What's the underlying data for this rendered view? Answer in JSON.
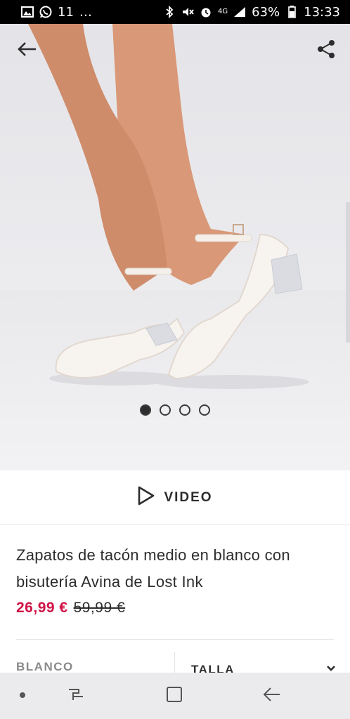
{
  "status_bar": {
    "notification_count": "11",
    "ellipsis": "…",
    "network": "4G",
    "battery": "63%",
    "time": "13:33"
  },
  "product": {
    "title": "Zapatos de tacón medio en blanco con bisutería Avina de Lost Ink",
    "price_now": "26,99 €",
    "price_old": "59,99 €",
    "gallery_count": 4,
    "gallery_active_index": 0
  },
  "video": {
    "label": "VIDEO"
  },
  "selectors": {
    "colour": "BLANCO",
    "size_label": "TALLA"
  },
  "icons": {
    "back": "arrow-left-icon",
    "share": "share-icon",
    "video": "play-icon",
    "size_dropdown": "chevron-down-icon"
  },
  "colors": {
    "accent_price": "#d01345",
    "text": "#2d2d2d"
  }
}
